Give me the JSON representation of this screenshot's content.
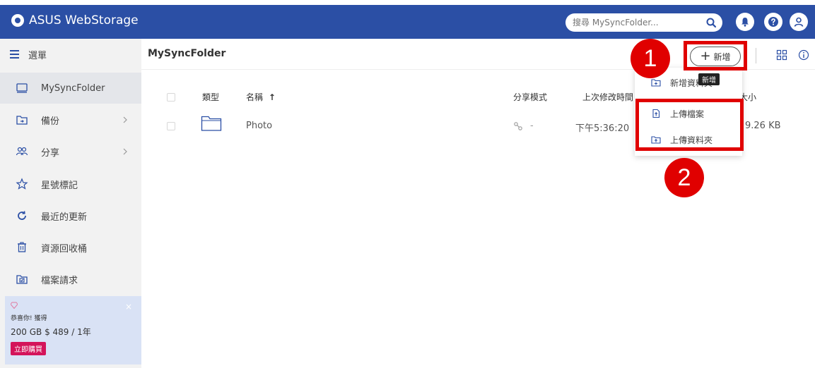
{
  "header": {
    "app_title": "ASUS WebStorage",
    "search_placeholder": "搜尋 MySyncFolder..."
  },
  "sidebar": {
    "menu_label": "選單",
    "items": [
      {
        "label": "MySyncFolder",
        "icon": "drive-icon",
        "active": true
      },
      {
        "label": "備份",
        "icon": "backup-folder-icon",
        "has_submenu": true
      },
      {
        "label": "分享",
        "icon": "people-icon",
        "has_submenu": true
      },
      {
        "label": "星號標記",
        "icon": "star-icon"
      },
      {
        "label": "最近的更新",
        "icon": "refresh-icon"
      },
      {
        "label": "資源回收桶",
        "icon": "trash-icon"
      },
      {
        "label": "檔案請求",
        "icon": "file-request-icon"
      }
    ],
    "promo": {
      "close": "×",
      "line1": "恭喜你! 獲得",
      "line2": "200 GB $ 489 / 1年",
      "buy_label": "立即購買"
    }
  },
  "main": {
    "breadcrumb": "MySyncFolder",
    "add_button_label": "新增",
    "tooltip": "新增",
    "columns": {
      "type": "類型",
      "name": "名稱",
      "share_mode": "分享模式",
      "modified": "上次修改時間",
      "size": "大小"
    },
    "sort_indicator": "↑",
    "rows": [
      {
        "name": "Photo",
        "share_mode": "-",
        "modified": "下午5:36:20",
        "size": "9.26 KB"
      }
    ]
  },
  "dropdown": {
    "items": [
      {
        "label": "新增資料夾",
        "icon": "new-folder-icon"
      },
      {
        "label": "上傳檔案",
        "icon": "upload-file-icon"
      },
      {
        "label": "上傳資料夾",
        "icon": "upload-folder-icon"
      }
    ]
  },
  "annotations": {
    "marker1": "1",
    "marker2": "2"
  },
  "colors": {
    "header": "#2b4fa5",
    "highlight": "#e00000",
    "buy_button": "#d4145a"
  }
}
